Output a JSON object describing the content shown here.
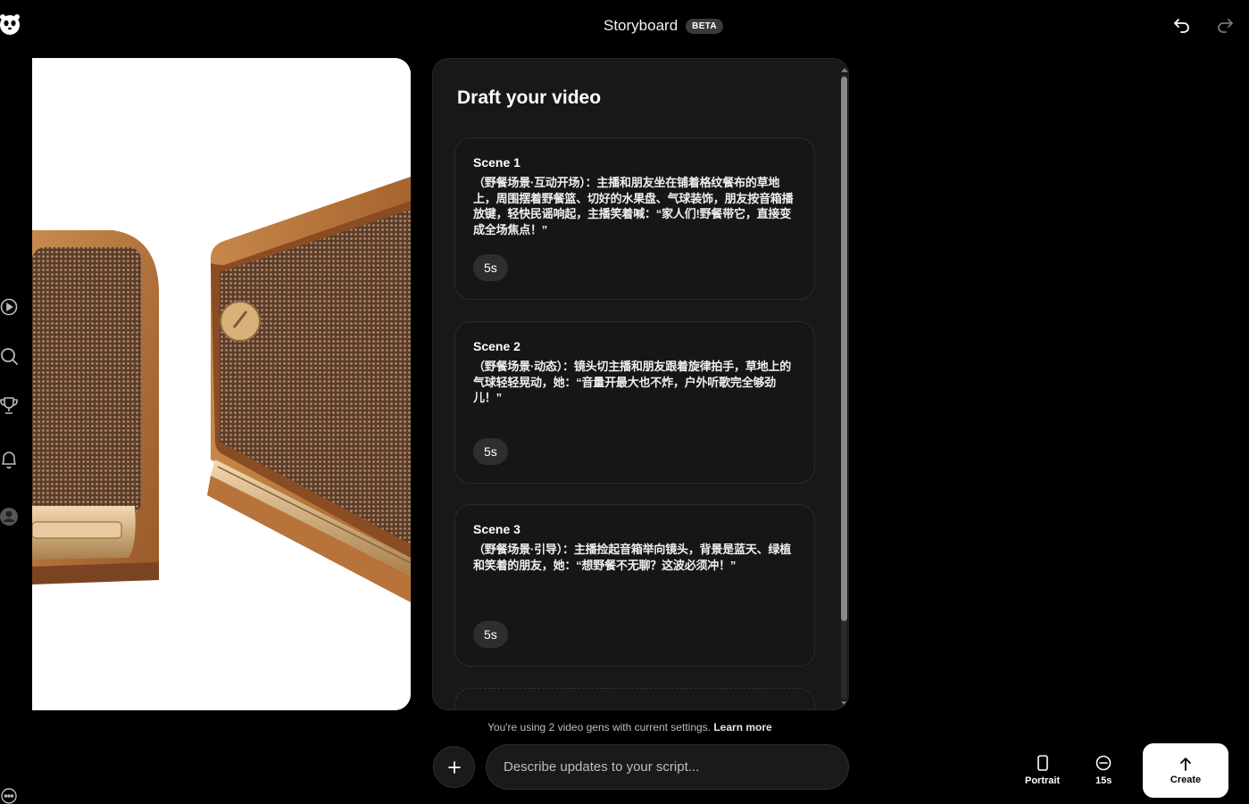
{
  "header": {
    "title": "Storyboard",
    "badge": "BETA"
  },
  "panel": {
    "title": "Draft your video",
    "scenes": [
      {
        "label": "Scene 1",
        "text": "（野餐场景·互动开场）：主播和朋友坐在铺着格纹餐布的草地上，周围摆着野餐篮、切好的水果盘、气球装饰，朋友按音箱播放键，轻快民谣响起，主播笑着喊：“家人们!野餐带它，直接变成全场焦点！”",
        "duration": "5s"
      },
      {
        "label": "Scene 2",
        "text": "（野餐场景·动态）：镜头切主播和朋友跟着旋律拍手，草地上的气球轻轻晃动，她：“音量开最大也不炸，户外听歌完全够劲儿！”",
        "duration": "5s"
      },
      {
        "label": "Scene 3",
        "text": "（野餐场景·引导）：主播捡起音箱举向镜头，背景是蓝天、绿植和笑着的朋友，她：“想野餐不无聊？这波必须冲！”",
        "duration": "5s"
      }
    ]
  },
  "footer": {
    "info_text": "You're using 2 video gens with current settings.",
    "learn_more": "Learn more",
    "input_placeholder": "Describe updates to your script...",
    "orientation": "Portrait",
    "length": "15s",
    "create": "Create"
  },
  "icons": {
    "logo": "panda-logo-icon",
    "undo": "undo-icon",
    "redo": "redo-icon",
    "rail": [
      "video-play-icon",
      "search-icon",
      "trophy-icon",
      "bell-icon",
      "profile-icon",
      "more-icon"
    ]
  }
}
